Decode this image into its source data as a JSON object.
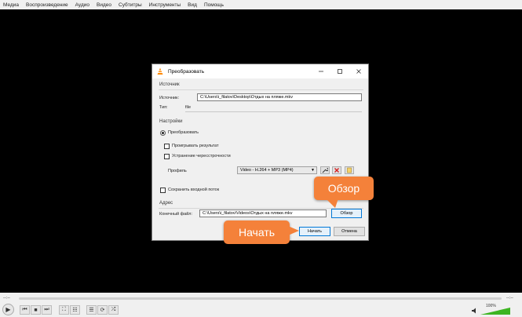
{
  "menu": [
    "Медиа",
    "Воспроизведение",
    "Аудио",
    "Видео",
    "Субтитры",
    "Инструменты",
    "Вид",
    "Помощь"
  ],
  "dialog": {
    "title": "Преобразовать",
    "source_group": "Источник",
    "source_label": "Источник:",
    "source_value": "C:\\Users\\i_filatov\\Desktop\\Отдых на пляже.mkv",
    "type_label": "Тип:",
    "type_value": "file",
    "settings_group": "Настройки",
    "convert_label": "Преобразовать",
    "play_result_label": "Проигрывать результат",
    "deinterlace_label": "Устранение чересстрочности",
    "profile_label": "Профиль",
    "profile_value": "Video - H.264 + MP3 (MP4)",
    "keep_stream_label": "Сохранить входной поток",
    "address_group": "Адрес",
    "dest_label": "Конечный файл:",
    "dest_value": "C:\\Users\\i_filatov\\Videos\\Отдых на пляже.mkv",
    "browse_label": "Обзор",
    "start_label": "Начать",
    "cancel_label": "Отмена"
  },
  "callouts": {
    "browse": "Обзор",
    "start": "Начать"
  },
  "controls": {
    "time_left": "--:--",
    "time_right": "--:--",
    "volume": "100%"
  },
  "colors": {
    "accent": "#f4813a",
    "vlc_orange": "#ff8800",
    "volume_green": "#3cb521"
  }
}
